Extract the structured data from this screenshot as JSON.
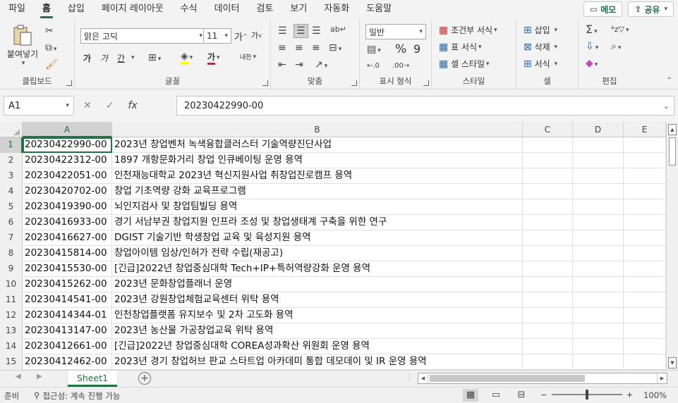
{
  "menu": {
    "tabs": [
      "파일",
      "홈",
      "삽입",
      "페이지 레이아웃",
      "수식",
      "데이터",
      "검토",
      "보기",
      "자동화",
      "도움말"
    ],
    "active": "홈",
    "memo_label": "메모",
    "share_label": "공유"
  },
  "ribbon": {
    "clipboard": {
      "label": "클립보드",
      "paste": "붙여넣기"
    },
    "font": {
      "label": "글꼴",
      "font_name": "맑은 고딕",
      "font_size": "11",
      "grow": "가",
      "shrink": "가",
      "bold": "가",
      "italic": "가",
      "underline": "간",
      "phonetic": "내천"
    },
    "alignment": {
      "label": "맞춤"
    },
    "number": {
      "label": "표시 형식",
      "format": "일반",
      "percent": "%",
      "comma": "9"
    },
    "styles": {
      "label": "스타일",
      "conditional": "조건부 서식",
      "table": "표 서식",
      "cell": "셀 스타일"
    },
    "cells": {
      "label": "셀",
      "insert": "삽입",
      "delete": "삭제",
      "format": "서식"
    },
    "editing": {
      "label": "편집"
    }
  },
  "formula_bar": {
    "name_box": "A1",
    "fx": "fx",
    "value": "20230422990-00"
  },
  "grid": {
    "columns": [
      "A",
      "B",
      "C",
      "D",
      "E"
    ],
    "rows": [
      {
        "num": "1",
        "a": "20230422990-00",
        "b": "2023년 창업벤처 녹색융합클러스터 기술역량진단사업"
      },
      {
        "num": "2",
        "a": "20230422312-00",
        "b": "1897 개항문화거리 창업 인큐베이팅 운영 용역"
      },
      {
        "num": "3",
        "a": "20230422051-00",
        "b": "인천재능대학교 2023년 혁신지원사업 취창업진로캠프 용역"
      },
      {
        "num": "4",
        "a": "20230420702-00",
        "b": "창업 기초역량 강화 교육프로그램"
      },
      {
        "num": "5",
        "a": "20230419390-00",
        "b": "뇌인지검사 및 창업팀빌딩 용역"
      },
      {
        "num": "6",
        "a": "20230416933-00",
        "b": "경기 서남부권 창업지원 인프라 조성 및 창업생태계 구축을 위한 연구"
      },
      {
        "num": "7",
        "a": "20230416627-00",
        "b": "DGIST 기술기반 학생창업 교육 및 육성지원 용역"
      },
      {
        "num": "8",
        "a": "20230415814-00",
        "b": "창업아이템 임상/인허가 전략 수립(재공고)"
      },
      {
        "num": "9",
        "a": "20230415530-00",
        "b": "[긴급]2022년 창업중심대학 Tech+IP+특허역량강화 운영 용역"
      },
      {
        "num": "10",
        "a": "20230415262-00",
        "b": "2023년 문화창업플래너 운영"
      },
      {
        "num": "11",
        "a": "20230414541-00",
        "b": "2023년 강원창업체험교육센터 위탁 용역"
      },
      {
        "num": "12",
        "a": "20230414344-01",
        "b": "인천창업플랫폼 유지보수 및 2차 고도화 용역"
      },
      {
        "num": "13",
        "a": "20230413147-00",
        "b": "2023년 농산물 가공창업교육 위탁 용역"
      },
      {
        "num": "14",
        "a": "20230412661-00",
        "b": "[긴급]2022년 창업중심대학 COREA성과확산 위원회 운영 용역"
      },
      {
        "num": "15",
        "a": "20230412462-00",
        "b": "2023년 경기 창업허브 판교 스타트업 아카데미 통합 데모데이 및 IR 운영 용역"
      }
    ]
  },
  "sheets": {
    "tabs": [
      "Sheet1"
    ],
    "active": "Sheet1"
  },
  "status": {
    "ready": "준비",
    "accessibility": "접근성: 계속 진행 가능",
    "zoom": "100%"
  },
  "colors": {
    "accent": "#217346"
  }
}
